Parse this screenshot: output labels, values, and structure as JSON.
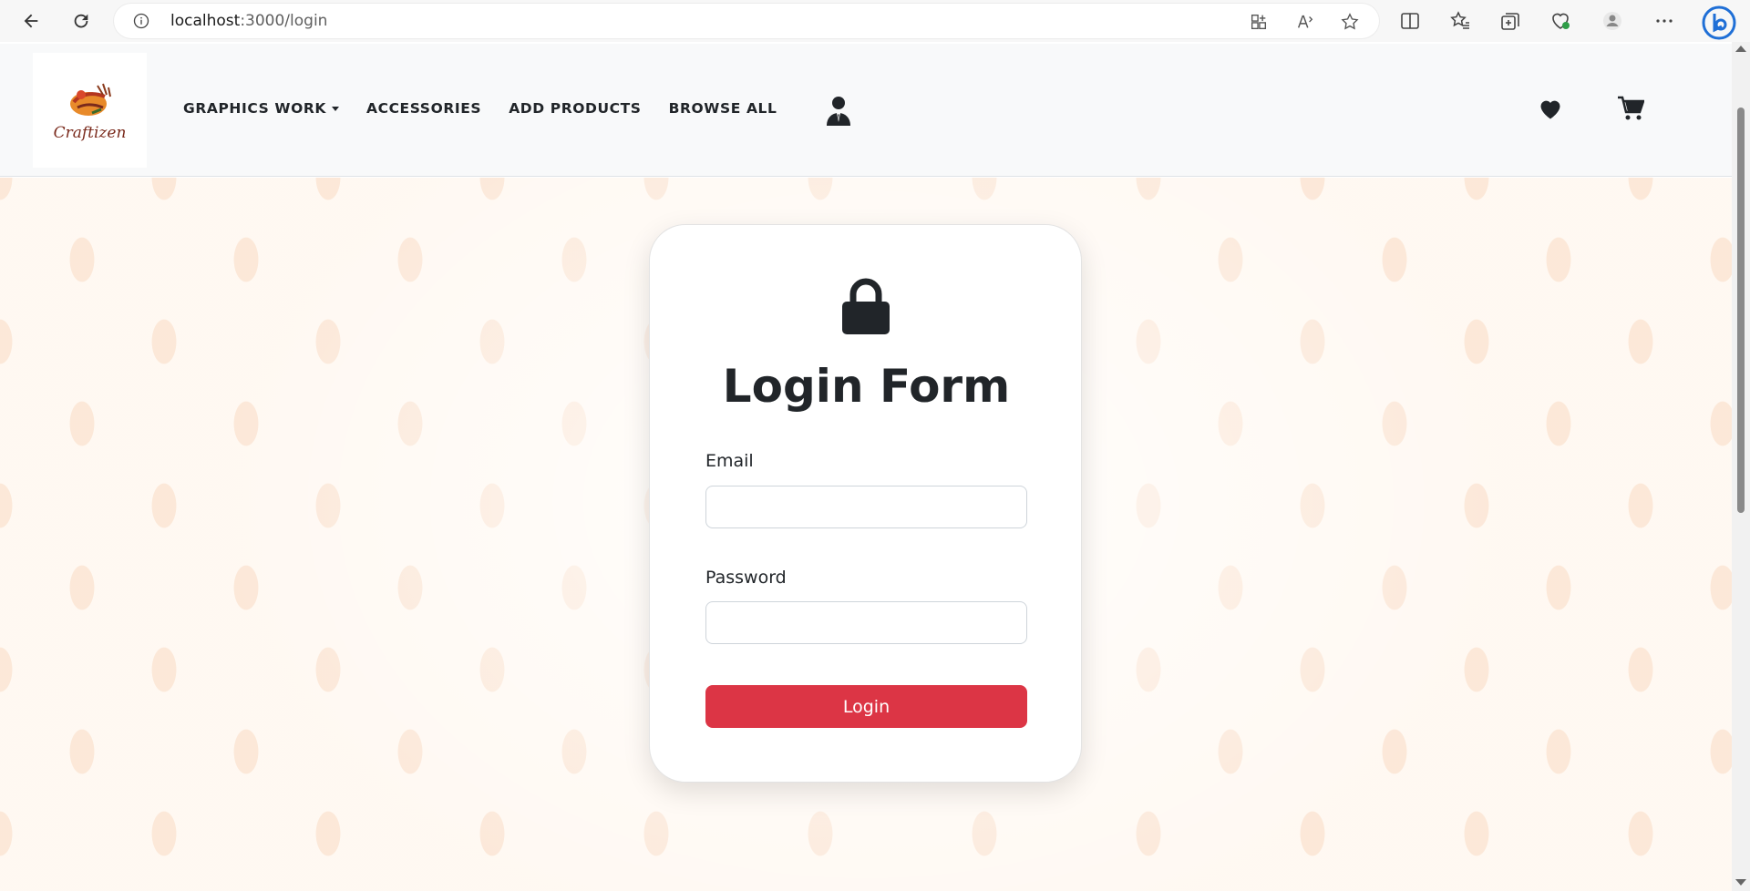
{
  "browser": {
    "url_host": "localhost",
    "url_path": ":3000/login",
    "icons": [
      "back-arrow-icon",
      "reload-icon",
      "info-icon",
      "app-available-icon",
      "read-aloud-icon",
      "favorite-star-icon",
      "split-screen-icon",
      "favorites-icon",
      "collections-icon",
      "browser-essentials-icon",
      "profile-icon",
      "more-icon",
      "copilot-icon"
    ]
  },
  "navbar": {
    "logo_text": "Craftizen",
    "links": [
      {
        "label": "GRAPHICS WORK",
        "has_dropdown": true
      },
      {
        "label": "ACCESSORIES",
        "has_dropdown": false
      },
      {
        "label": "ADD PRODUCTS",
        "has_dropdown": false
      },
      {
        "label": "BROWSE ALL",
        "has_dropdown": false
      }
    ],
    "icons": [
      "user-icon",
      "heart-icon",
      "cart-icon"
    ]
  },
  "login": {
    "title": "Login Form",
    "email_label": "Email",
    "email_value": "",
    "password_label": "Password",
    "password_value": "",
    "button_label": "Login",
    "button_color": "#dc3545"
  },
  "colors": {
    "navbar_bg": "#f8f9fa",
    "page_bg": "#fff7ef",
    "text": "#212529"
  }
}
